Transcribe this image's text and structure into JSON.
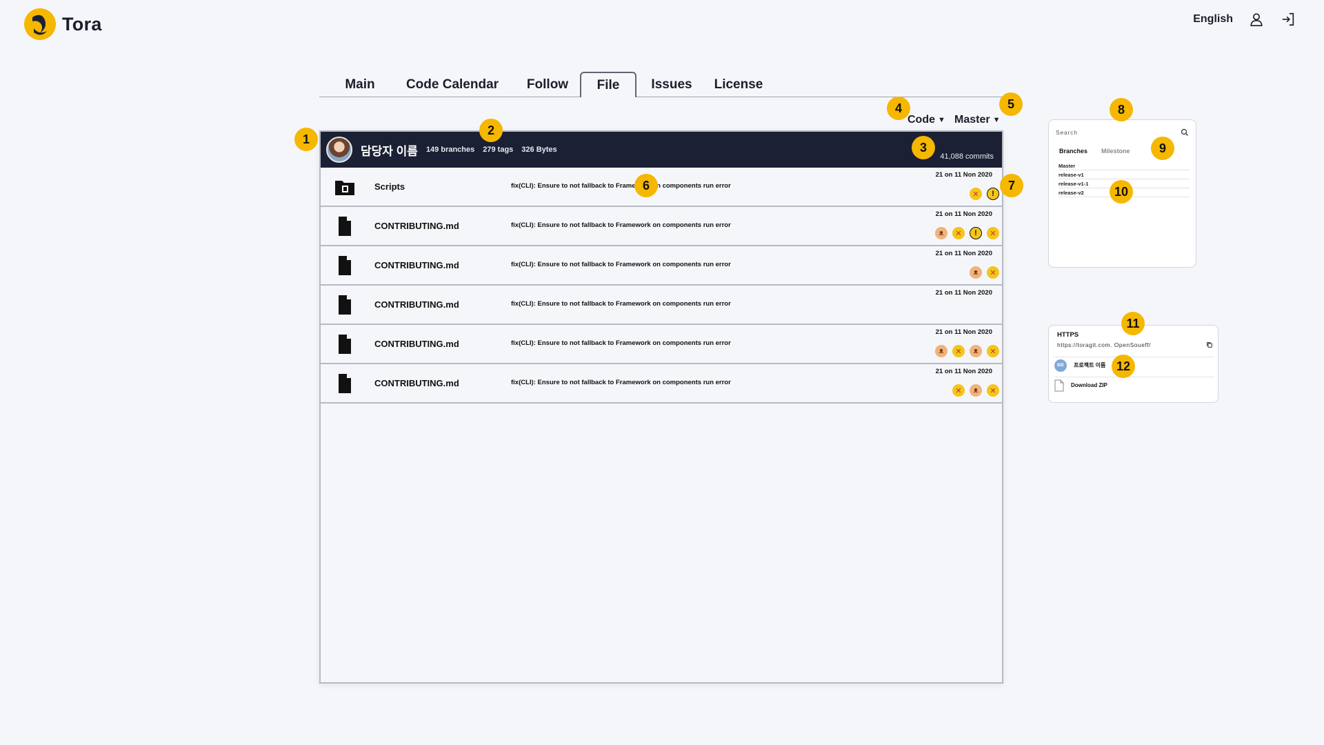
{
  "brand": {
    "name": "Tora"
  },
  "header": {
    "language": "English"
  },
  "tabs": [
    {
      "label": "Main"
    },
    {
      "label": "Code Calendar"
    },
    {
      "label": "Follow"
    },
    {
      "label": "File"
    },
    {
      "label": "Issues"
    },
    {
      "label": "License"
    }
  ],
  "dropdowns": {
    "code": "Code",
    "branch": "Master"
  },
  "repo": {
    "owner": "담당자 이름",
    "branches": "149 branches",
    "tags": "279 tags",
    "size": "326 Bytes",
    "commits": "41,088 commits"
  },
  "files": [
    {
      "name": "Scripts",
      "type": "folder",
      "message": "fix(CLI): Ensure to not fallback to Framework on components run error",
      "date": "21 on 11 Non 2020",
      "emojis": [
        "angry",
        "warn"
      ]
    },
    {
      "name": "CONTRIBUTING.md",
      "type": "file",
      "message": "fix(CLI): Ensure to not fallback to Framework on components run error",
      "date": "21 on 11 Non 2020",
      "emojis": [
        "cat",
        "angry",
        "warn",
        "angry"
      ]
    },
    {
      "name": "CONTRIBUTING.md",
      "type": "file",
      "message": "fix(CLI): Ensure to not fallback to Framework on components run error",
      "date": "21 on 11 Non 2020",
      "emojis": [
        "cat",
        "angry"
      ]
    },
    {
      "name": "CONTRIBUTING.md",
      "type": "file",
      "message": "fix(CLI): Ensure to not fallback to Framework on components run error",
      "date": "21 on 11 Non 2020",
      "emojis": []
    },
    {
      "name": "CONTRIBUTING.md",
      "type": "file",
      "message": "fix(CLI): Ensure to not fallback to Framework on components run error",
      "date": "21 on 11 Non 2020",
      "emojis": [
        "cat",
        "angry",
        "cat",
        "angry"
      ]
    },
    {
      "name": "CONTRIBUTING.md",
      "type": "file",
      "message": "fix(CLI): Ensure to not fallback to Framework on components run error",
      "date": "21 on 11 Non 2020",
      "emojis": [
        "angry",
        "cat",
        "angry"
      ]
    }
  ],
  "branch_panel": {
    "search_placeholder": "Search",
    "tab_branches": "Branches",
    "tab_milestone": "Milestone",
    "items": [
      "Master",
      "release-v1",
      "release-v1-1",
      "release-v2"
    ]
  },
  "clone_panel": {
    "protocol": "HTTPS",
    "url": "https://toragit.com. OpenSoueff/",
    "ide_badge": "IDE",
    "project_label": "프로젝트 이름",
    "download_label": "Download ZIP"
  },
  "markers": [
    "1",
    "2",
    "3",
    "4",
    "5",
    "6",
    "7",
    "8",
    "9",
    "10",
    "11",
    "12"
  ],
  "colors": {
    "accent": "#f6b700",
    "header_bar": "#1c2035",
    "background": "#f5f6fa"
  }
}
